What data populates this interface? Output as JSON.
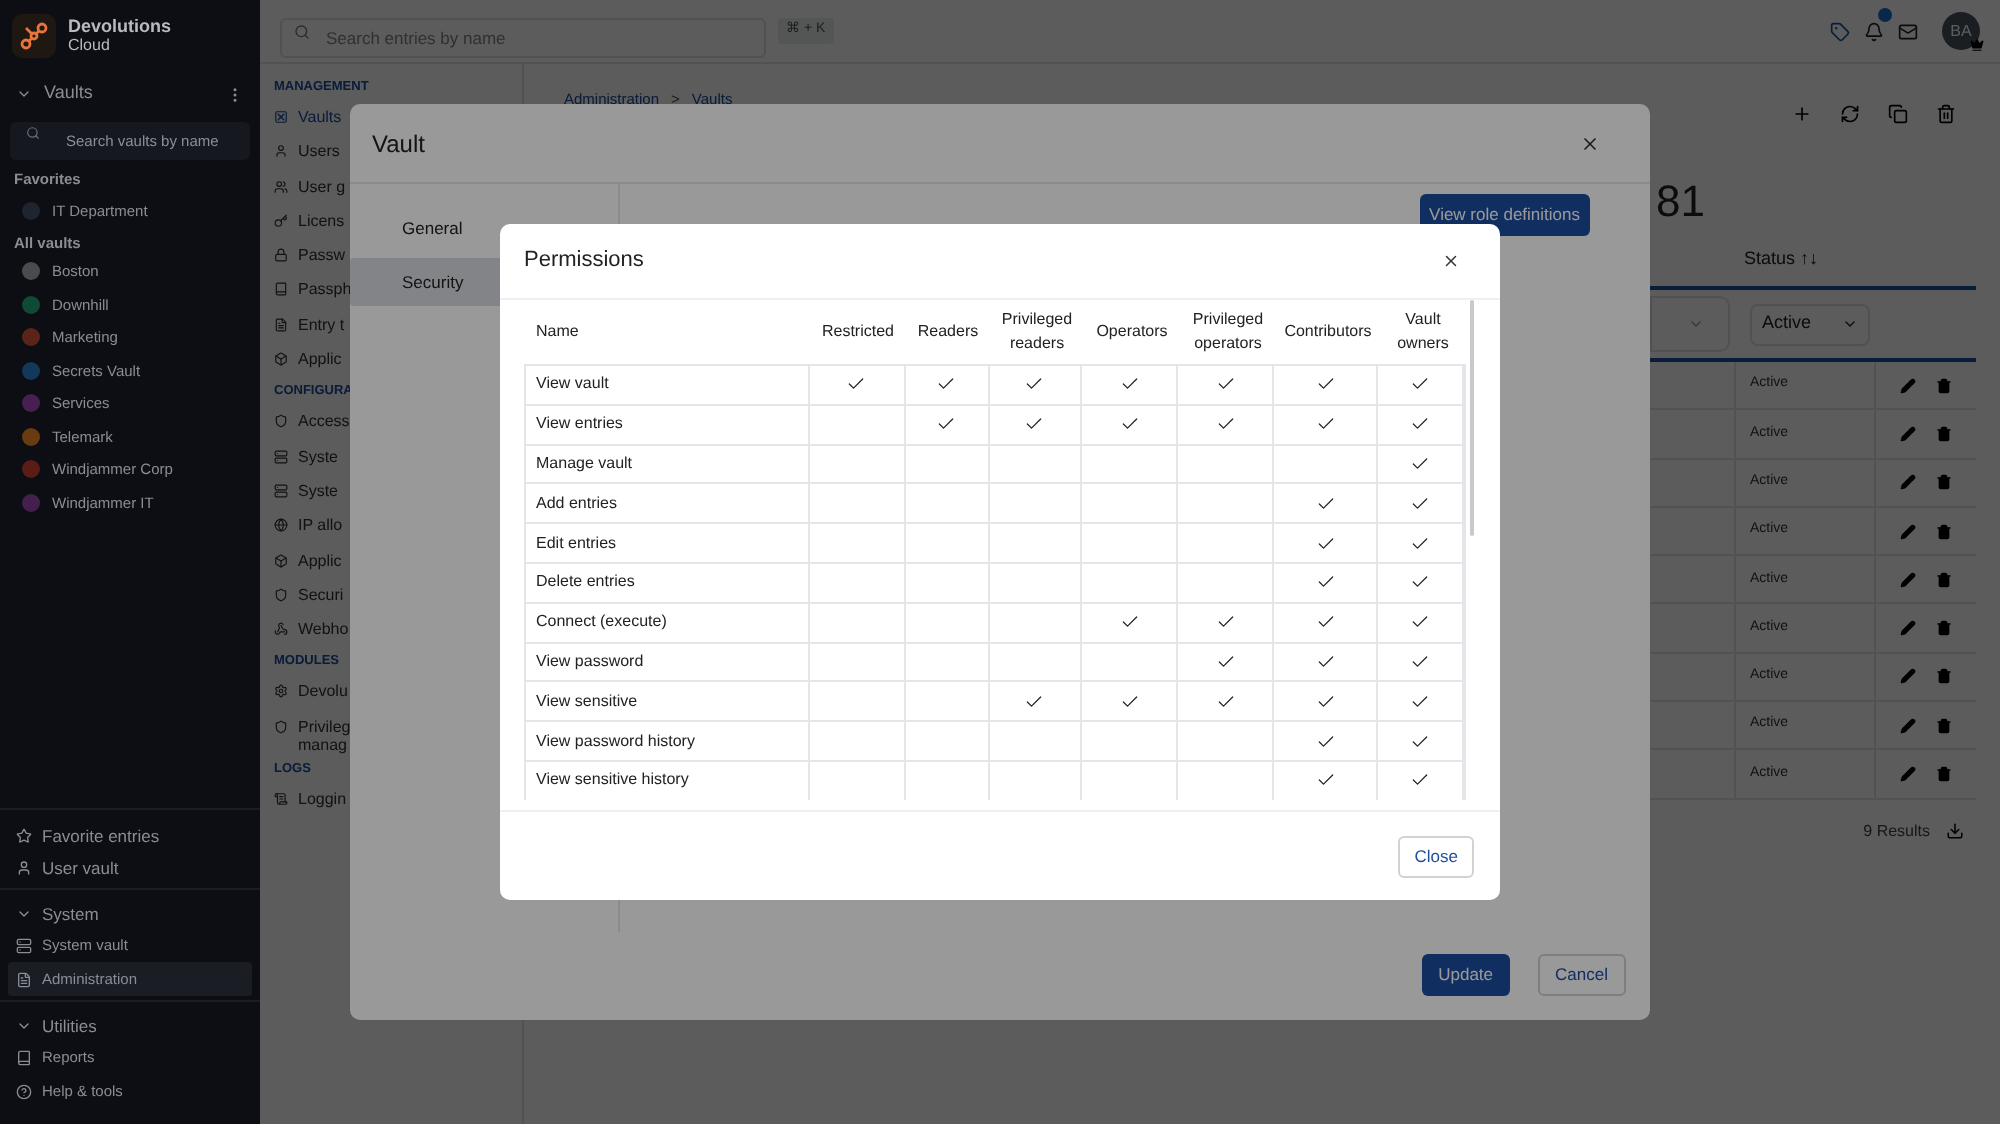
{
  "sidebar": {
    "logo": {
      "line1": "Devolutions",
      "line2": "Cloud"
    },
    "vaults_header": "Vaults",
    "search_placeholder": "Search vaults by name",
    "favorites_title": "Favorites",
    "favorites": [
      {
        "name": "IT Department",
        "color": "#1e2530"
      }
    ],
    "all_title": "All vaults",
    "vaults": [
      {
        "name": "Boston",
        "color": "#4a4b4e"
      },
      {
        "name": "Downhill",
        "color": "#0e4a35"
      },
      {
        "name": "Marketing",
        "color": "#5a2418"
      },
      {
        "name": "Secrets Vault",
        "color": "#12385a"
      },
      {
        "name": "Services",
        "color": "#452050"
      },
      {
        "name": "Telemark",
        "color": "#6a3a10"
      },
      {
        "name": "Windjammer Corp",
        "color": "#5a1c15"
      },
      {
        "name": "Windjammer IT",
        "color": "#45204f"
      }
    ],
    "links": [
      "Favorite entries",
      "User vault"
    ],
    "sections": [
      {
        "title": "System",
        "expanded": true,
        "items": [
          {
            "label": "System vault",
            "selected": false
          },
          {
            "label": "Administration",
            "selected": true
          }
        ]
      },
      {
        "title": "Utilities",
        "expanded": true,
        "items": [
          {
            "label": "Reports",
            "selected": false
          },
          {
            "label": "Help & tools",
            "selected": false
          }
        ]
      }
    ]
  },
  "topbar": {
    "search_placeholder": "Search entries by name",
    "shortcut": "⌘ + K",
    "avatar": "BA"
  },
  "admin_nav": [
    {
      "title": "MANAGEMENT",
      "items": [
        {
          "label": "Vaults",
          "selected": true
        },
        {
          "label": "Users",
          "selected": false
        },
        {
          "label": "User g",
          "selected": false
        },
        {
          "label": "Licens",
          "selected": false
        },
        {
          "label": "Passw",
          "selected": false
        },
        {
          "label": "Passph",
          "selected": false
        },
        {
          "label": "Entry t",
          "selected": false
        },
        {
          "label": "Applic",
          "selected": false
        }
      ]
    },
    {
      "title": "CONFIGURA",
      "items": [
        {
          "label": "Access",
          "selected": false
        },
        {
          "label": "Syste",
          "selected": false
        },
        {
          "label": "Syste",
          "selected": false
        },
        {
          "label": "IP allo",
          "selected": false
        },
        {
          "label": "Applic",
          "selected": false
        },
        {
          "label": "Securi",
          "selected": false
        },
        {
          "label": "Webho",
          "selected": false
        }
      ]
    },
    {
      "title": "MODULES",
      "items": [
        {
          "label": "Devolu",
          "selected": false
        },
        {
          "label": "Privileg manag",
          "selected": false
        }
      ]
    },
    {
      "title": "LOGS",
      "items": [
        {
          "label": "Loggin",
          "selected": false
        }
      ]
    }
  ],
  "page": {
    "breadcrumb": [
      "Administration",
      "Vaults"
    ],
    "breadcrumb_separator": ">",
    "big_number": "81",
    "status_header": "Status ↑↓",
    "status_filter": "Active",
    "rows": [
      "Active",
      "Active",
      "Active",
      "Active",
      "Active",
      "Active",
      "Active",
      "Active",
      "Active"
    ],
    "results": "9 Results"
  },
  "vault_dialog": {
    "title": "Vault",
    "tabs": [
      {
        "label": "General",
        "selected": false
      },
      {
        "label": "Security",
        "selected": true
      }
    ],
    "role_button": "View role definitions",
    "update": "Update",
    "cancel": "Cancel"
  },
  "permissions_dialog": {
    "title": "Permissions",
    "columns": [
      "Name",
      "Restricted",
      "Readers",
      "Privileged readers",
      "Operators",
      "Privileged operators",
      "Contributors",
      "Vault owners"
    ],
    "rows": [
      {
        "name": "View vault",
        "checks": [
          true,
          true,
          true,
          true,
          true,
          true,
          true
        ]
      },
      {
        "name": "View entries",
        "checks": [
          false,
          true,
          true,
          true,
          true,
          true,
          true
        ]
      },
      {
        "name": "Manage vault",
        "checks": [
          false,
          false,
          false,
          false,
          false,
          false,
          true
        ]
      },
      {
        "name": "Add entries",
        "checks": [
          false,
          false,
          false,
          false,
          false,
          true,
          true
        ]
      },
      {
        "name": "Edit entries",
        "checks": [
          false,
          false,
          false,
          false,
          false,
          true,
          true
        ]
      },
      {
        "name": "Delete entries",
        "checks": [
          false,
          false,
          false,
          false,
          false,
          true,
          true
        ]
      },
      {
        "name": "Connect (execute)",
        "checks": [
          false,
          false,
          false,
          true,
          true,
          true,
          true
        ]
      },
      {
        "name": "View password",
        "checks": [
          false,
          false,
          false,
          false,
          true,
          true,
          true
        ]
      },
      {
        "name": "View sensitive",
        "checks": [
          false,
          false,
          true,
          true,
          true,
          true,
          true
        ]
      },
      {
        "name": "View password history",
        "checks": [
          false,
          false,
          false,
          false,
          false,
          true,
          true
        ]
      },
      {
        "name": "View sensitive history",
        "checks": [
          false,
          false,
          false,
          false,
          false,
          true,
          true
        ]
      }
    ],
    "close": "Close"
  }
}
